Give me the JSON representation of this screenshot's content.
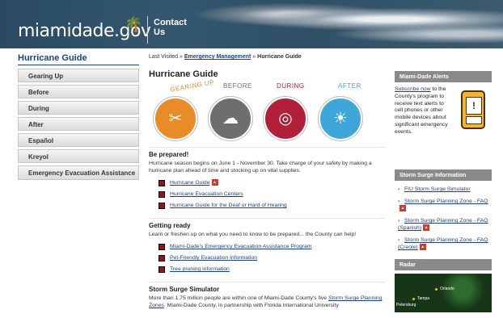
{
  "header": {
    "logo_text": "miamidade.gov",
    "contact_label": "Contact Us"
  },
  "sidebar": {
    "title": "Hurricane Guide",
    "items": [
      {
        "label": "Gearing Up"
      },
      {
        "label": "Before"
      },
      {
        "label": "During"
      },
      {
        "label": "After"
      },
      {
        "label": "Español"
      },
      {
        "label": "Kreyol"
      },
      {
        "label": "Emergency Evacuation Assistance"
      }
    ]
  },
  "breadcrumb": {
    "prefix": "Last Visited »",
    "link": "Emergency Management",
    "sep": "»",
    "current": "Hurricane Guide"
  },
  "main": {
    "title": "Hurricane Guide",
    "circles": [
      {
        "label": "GEARING UP",
        "color": "#e98b26",
        "label_color": "#e98b26",
        "glyph": "✂"
      },
      {
        "label": "BEFORE",
        "color": "#6e6e6e",
        "label_color": "#6e6e6e",
        "glyph": "☁"
      },
      {
        "label": "DURING",
        "color": "#b21f3a",
        "label_color": "#b21f3a",
        "glyph": "◎"
      },
      {
        "label": "AFTER",
        "color": "#3fa6d8",
        "label_color": "#3fa6d8",
        "glyph": "☀"
      }
    ],
    "prepared": {
      "heading": "Be prepared!",
      "text": "Hurricane season begins on June 1 - November 30. Take charge of your safety by making a hurricane plan ahead of time and stocking up on vital supplies.",
      "links": [
        {
          "label": "Hurricane Guide",
          "pdf": true
        },
        {
          "label": "Hurricane Evacuation Centers",
          "pdf": false
        },
        {
          "label": "Hurricane Guide for the Deaf or Hard of Hearing",
          "pdf": false
        }
      ]
    },
    "ready": {
      "heading": "Getting ready",
      "text": "Learn or freshen up on what you need to know to be prepared... the County can help!",
      "links": [
        {
          "label": "Miami-Dade's Emergency Evacuation Assistance Program"
        },
        {
          "label": "Pet-Friendly Evacuation Information"
        },
        {
          "label": "Tree pruning information"
        }
      ]
    },
    "simulator": {
      "heading": "Storm Surge Simulator",
      "text_before": "More than 1.75 million people are within one of Miami-Dade County's five",
      "link": "Storm Surge Planning Zones",
      "text_after": ". Miami-Dade County, in partnership with Florida International University"
    }
  },
  "right": {
    "alerts": {
      "title": "Miami-Dade Alerts",
      "link": "Subscribe now",
      "text": "to the County's program to receive text alerts to cell phones or other mobile devices about significant emergency events."
    },
    "storm": {
      "title": "Storm Surge Information",
      "items": [
        {
          "label": "FIU Storm Surge Simulator",
          "pdf": false
        },
        {
          "label": "Storm Surge Planning Zone - FAQ",
          "pdf": true
        },
        {
          "label": "Storm Surge Planning Zone - FAQ (Spanish)",
          "pdf": true
        },
        {
          "label": "Storm Surge Planning Zone - FAQ (Creole)",
          "pdf": true
        }
      ]
    },
    "radar": {
      "title": "Radar",
      "labels": [
        "Orlando",
        "Tampa",
        "Petersburg"
      ]
    }
  }
}
